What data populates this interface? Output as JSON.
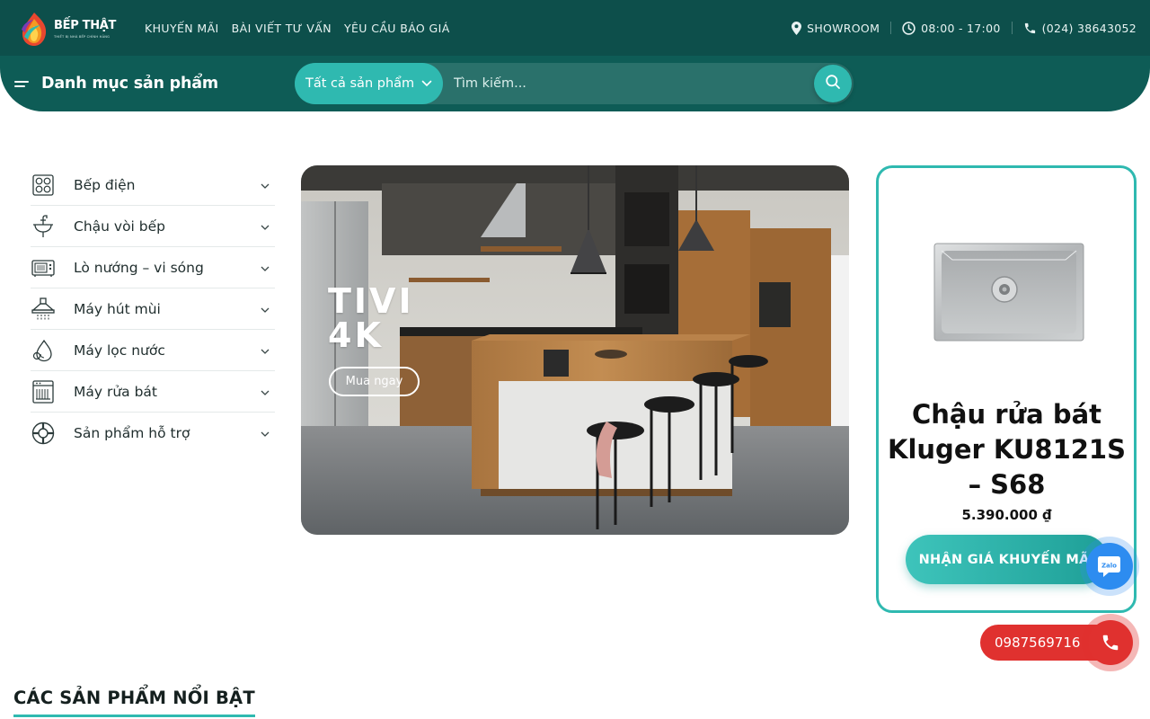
{
  "brand": {
    "name": "BẾP THẬT",
    "tagline": "THIẾT BỊ NHÀ BẾP CHÍNH HÃNG",
    "colors": {
      "primary": "#0d4f4b",
      "secondary": "#0e5c56",
      "accent": "#2fb9b0",
      "hotline": "#e0312f",
      "zalo": "#2d8cf0"
    }
  },
  "top_nav": {
    "links": [
      {
        "label": "KHUYẾN MÃI"
      },
      {
        "label": "BÀI VIẾT TƯ VẤN"
      },
      {
        "label": "YÊU CẦU BÁO GIÁ"
      }
    ],
    "showroom": {
      "label": "SHOWROOM",
      "icon": "map-pin-icon"
    },
    "hours": {
      "label": "08:00 - 17:00",
      "icon": "clock-icon"
    },
    "phone": {
      "label": "(024) 38643052",
      "icon": "phone-icon"
    }
  },
  "category_bar": {
    "title": "Danh mục sản phẩm",
    "icon": "menu-lines-icon"
  },
  "search": {
    "category": "Tất cả sản phẩm",
    "placeholder": "Tìm kiếm...",
    "icon": "search-icon"
  },
  "sidebar": {
    "items": [
      {
        "label": "Bếp điện",
        "icon": "cooktop-icon"
      },
      {
        "label": "Chậu vòi bếp",
        "icon": "faucet-icon"
      },
      {
        "label": "Lò nướng – vi sóng",
        "icon": "microwave-icon"
      },
      {
        "label": "Máy hút mùi",
        "icon": "range-hood-icon"
      },
      {
        "label": "Máy lọc nước",
        "icon": "water-drop-icon"
      },
      {
        "label": "Máy rửa bát",
        "icon": "dishwasher-icon"
      },
      {
        "label": "Sản phẩm hỗ trợ",
        "icon": "lifebuoy-icon"
      }
    ]
  },
  "banner": {
    "title": "TIVI 4K",
    "button": "Mua ngay"
  },
  "promo": {
    "title": "Chậu rửa bát Kluger KU8121S – S68",
    "price": "5.390.000 ₫",
    "button": "NHẬN GIÁ KHUYẾN MÃI"
  },
  "floating": {
    "zalo_label": "Zalo",
    "hotline": "0987569716"
  },
  "featured": {
    "title": "CÁC SẢN PHẨM NỔI BẬT"
  }
}
